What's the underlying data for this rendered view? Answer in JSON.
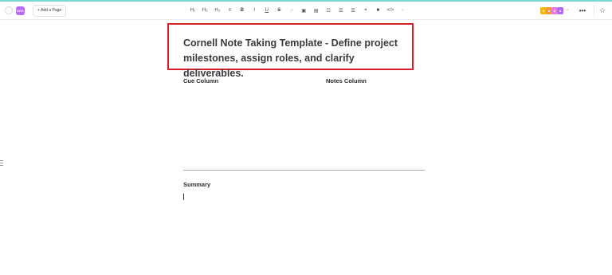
{
  "toolbar": {
    "doc_chip": "DOC",
    "add_page_label": "+ Add a Page",
    "format_buttons": [
      {
        "name": "heading-1-button",
        "label": "H₁"
      },
      {
        "name": "heading-2-button",
        "label": "H₂"
      },
      {
        "name": "heading-3-button",
        "label": "H₃"
      },
      {
        "name": "align-button",
        "label": "≡"
      },
      {
        "name": "bold-button",
        "label": "B"
      },
      {
        "name": "italic-button",
        "label": "I"
      },
      {
        "name": "underline-button",
        "label": "U"
      },
      {
        "name": "strikethrough-button",
        "label": "S"
      },
      {
        "name": "link-button",
        "label": "↗"
      },
      {
        "name": "image-button",
        "label": "▣"
      },
      {
        "name": "embed-button",
        "label": "▤"
      },
      {
        "name": "table-button",
        "label": "☷"
      },
      {
        "name": "bullet-list-button",
        "label": "☰"
      },
      {
        "name": "numbered-list-button",
        "label": "☰"
      },
      {
        "name": "quote-button",
        "label": "❝"
      },
      {
        "name": "block-button",
        "label": "■"
      },
      {
        "name": "code-button",
        "label": "</>"
      },
      {
        "name": "search-button",
        "label": "⌕"
      }
    ],
    "avatars": [
      {
        "initial": "A",
        "color": "#f4b400"
      },
      {
        "initial": "A",
        "color": "#f29a2e"
      },
      {
        "initial": "A",
        "color": "#ea7bd8"
      },
      {
        "initial": "A",
        "color": "#b06cf0"
      }
    ],
    "avatar_arrow": "→",
    "more_label": "•••",
    "star_label": "☆"
  },
  "document": {
    "title": "Cornell Note Taking Template - Define project milestones, assign roles, and clarify deliverables.",
    "cue_column_heading": "Cue Column",
    "notes_column_heading": "Notes Column",
    "summary_heading": "Summary"
  },
  "colors": {
    "highlight_border": "#d6202a",
    "top_accent": "#7ad8d8",
    "doc_chip": "#b86bff"
  }
}
